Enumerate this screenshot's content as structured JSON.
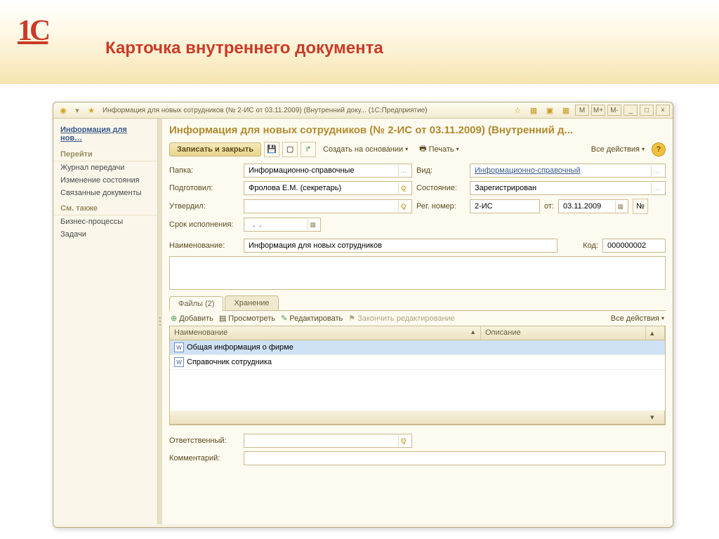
{
  "slide": {
    "title": "Карточка внутреннего документа"
  },
  "window": {
    "title": "Информация для новых сотрудников (№ 2-ИС от 03.11.2009) (Внутренний доку...  (1С:Предприятие)",
    "tb_icons": {
      "m": "M",
      "mplus": "M+",
      "mminus": "M-"
    }
  },
  "sidebar": {
    "head": "Информация для нов…",
    "sect_goto": "Перейти",
    "links_goto": [
      "Журнал передачи",
      "Изменение состояния",
      "Связанные документы"
    ],
    "sect_see": "См. также",
    "links_see": [
      "Бизнес-процессы",
      "Задачи"
    ]
  },
  "doc": {
    "title": "Информация для новых сотрудников (№ 2-ИС от 03.11.2009) (Внутренний д...",
    "toolbar": {
      "save_close": "Записать и закрыть",
      "create_based": "Создать на основании",
      "print": "Печать",
      "all_actions": "Все действия"
    },
    "labels": {
      "folder": "Папка:",
      "prepared": "Подготовил:",
      "approved": "Утвердил:",
      "deadline": "Срок исполнения:",
      "kind": "Вид:",
      "state": "Состояние:",
      "regnum": "Рег. номер:",
      "from": "от:",
      "name": "Наименование:",
      "code": "Код:",
      "responsible": "Ответственный:",
      "comment": "Комментарий:"
    },
    "values": {
      "folder": "Информационно-справочные",
      "prepared": "Фролова Е.М. (секретарь)",
      "approved": "",
      "deadline": "  .  .",
      "kind": "Информационно-справочный",
      "state": "Зарегистрирован",
      "regnum": "2-ИС",
      "date": "03.11.2009",
      "name": "Информация для новых сотрудников",
      "code": "000000002",
      "responsible": "",
      "comment": "",
      "number_btn": "№"
    },
    "tabs": {
      "files": "Файлы (2)",
      "storage": "Хранение"
    },
    "grid_toolbar": {
      "add": "Добавить",
      "view": "Просмотреть",
      "edit": "Редактировать",
      "finish": "Закончить редактирование",
      "all": "Все действия"
    },
    "grid": {
      "col_name": "Наименование",
      "col_desc": "Описание",
      "rows": [
        {
          "name": "Общая информация о фирме",
          "desc": ""
        },
        {
          "name": "Справочник сотрудника",
          "desc": ""
        }
      ]
    }
  }
}
